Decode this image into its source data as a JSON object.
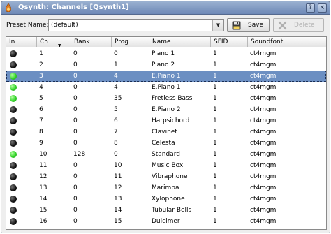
{
  "window": {
    "title": "Qsynth: Channels [Qsynth1]",
    "controls": [
      "?",
      "×"
    ]
  },
  "preset": {
    "label": "Preset Name:",
    "value": "(default)"
  },
  "buttons": {
    "save": "Save",
    "delete": "Delete"
  },
  "table": {
    "headers": [
      "In",
      "Ch",
      "Bank",
      "Prog",
      "Name",
      "SFID",
      "Soundfont"
    ],
    "sort_column": "Ch",
    "rows": [
      {
        "active": false,
        "ch": "1",
        "bank": "0",
        "prog": "0",
        "name": "Piano 1",
        "sfid": "1",
        "soundfont": "ct4mgm"
      },
      {
        "active": false,
        "ch": "2",
        "bank": "0",
        "prog": "1",
        "name": "Piano 2",
        "sfid": "1",
        "soundfont": "ct4mgm"
      },
      {
        "active": true,
        "ch": "3",
        "bank": "0",
        "prog": "4",
        "name": "E.Piano 1",
        "sfid": "1",
        "soundfont": "ct4mgm",
        "selected": true
      },
      {
        "active": true,
        "ch": "4",
        "bank": "0",
        "prog": "4",
        "name": "E.Piano 1",
        "sfid": "1",
        "soundfont": "ct4mgm"
      },
      {
        "active": true,
        "ch": "5",
        "bank": "0",
        "prog": "35",
        "name": "Fretless Bass",
        "sfid": "1",
        "soundfont": "ct4mgm"
      },
      {
        "active": false,
        "ch": "6",
        "bank": "0",
        "prog": "5",
        "name": "E.Piano 2",
        "sfid": "1",
        "soundfont": "ct4mgm"
      },
      {
        "active": false,
        "ch": "7",
        "bank": "0",
        "prog": "6",
        "name": "Harpsichord",
        "sfid": "1",
        "soundfont": "ct4mgm"
      },
      {
        "active": false,
        "ch": "8",
        "bank": "0",
        "prog": "7",
        "name": "Clavinet",
        "sfid": "1",
        "soundfont": "ct4mgm"
      },
      {
        "active": false,
        "ch": "9",
        "bank": "0",
        "prog": "8",
        "name": "Celesta",
        "sfid": "1",
        "soundfont": "ct4mgm"
      },
      {
        "active": true,
        "ch": "10",
        "bank": "128",
        "prog": "0",
        "name": "Standard",
        "sfid": "1",
        "soundfont": "ct4mgm"
      },
      {
        "active": false,
        "ch": "11",
        "bank": "0",
        "prog": "10",
        "name": "Music Box",
        "sfid": "1",
        "soundfont": "ct4mgm"
      },
      {
        "active": false,
        "ch": "12",
        "bank": "0",
        "prog": "11",
        "name": "Vibraphone",
        "sfid": "1",
        "soundfont": "ct4mgm"
      },
      {
        "active": false,
        "ch": "13",
        "bank": "0",
        "prog": "12",
        "name": "Marimba",
        "sfid": "1",
        "soundfont": "ct4mgm"
      },
      {
        "active": false,
        "ch": "14",
        "bank": "0",
        "prog": "13",
        "name": "Xylophone",
        "sfid": "1",
        "soundfont": "ct4mgm"
      },
      {
        "active": false,
        "ch": "15",
        "bank": "0",
        "prog": "14",
        "name": "Tubular Bells",
        "sfid": "1",
        "soundfont": "ct4mgm"
      },
      {
        "active": false,
        "ch": "16",
        "bank": "0",
        "prog": "15",
        "name": "Dulcimer",
        "sfid": "1",
        "soundfont": "ct4mgm"
      }
    ]
  },
  "colors": {
    "titlebar": "#7f98c2",
    "selection": "#6c8fc2",
    "led_active": "#34d62a",
    "led_inactive": "#111111"
  }
}
